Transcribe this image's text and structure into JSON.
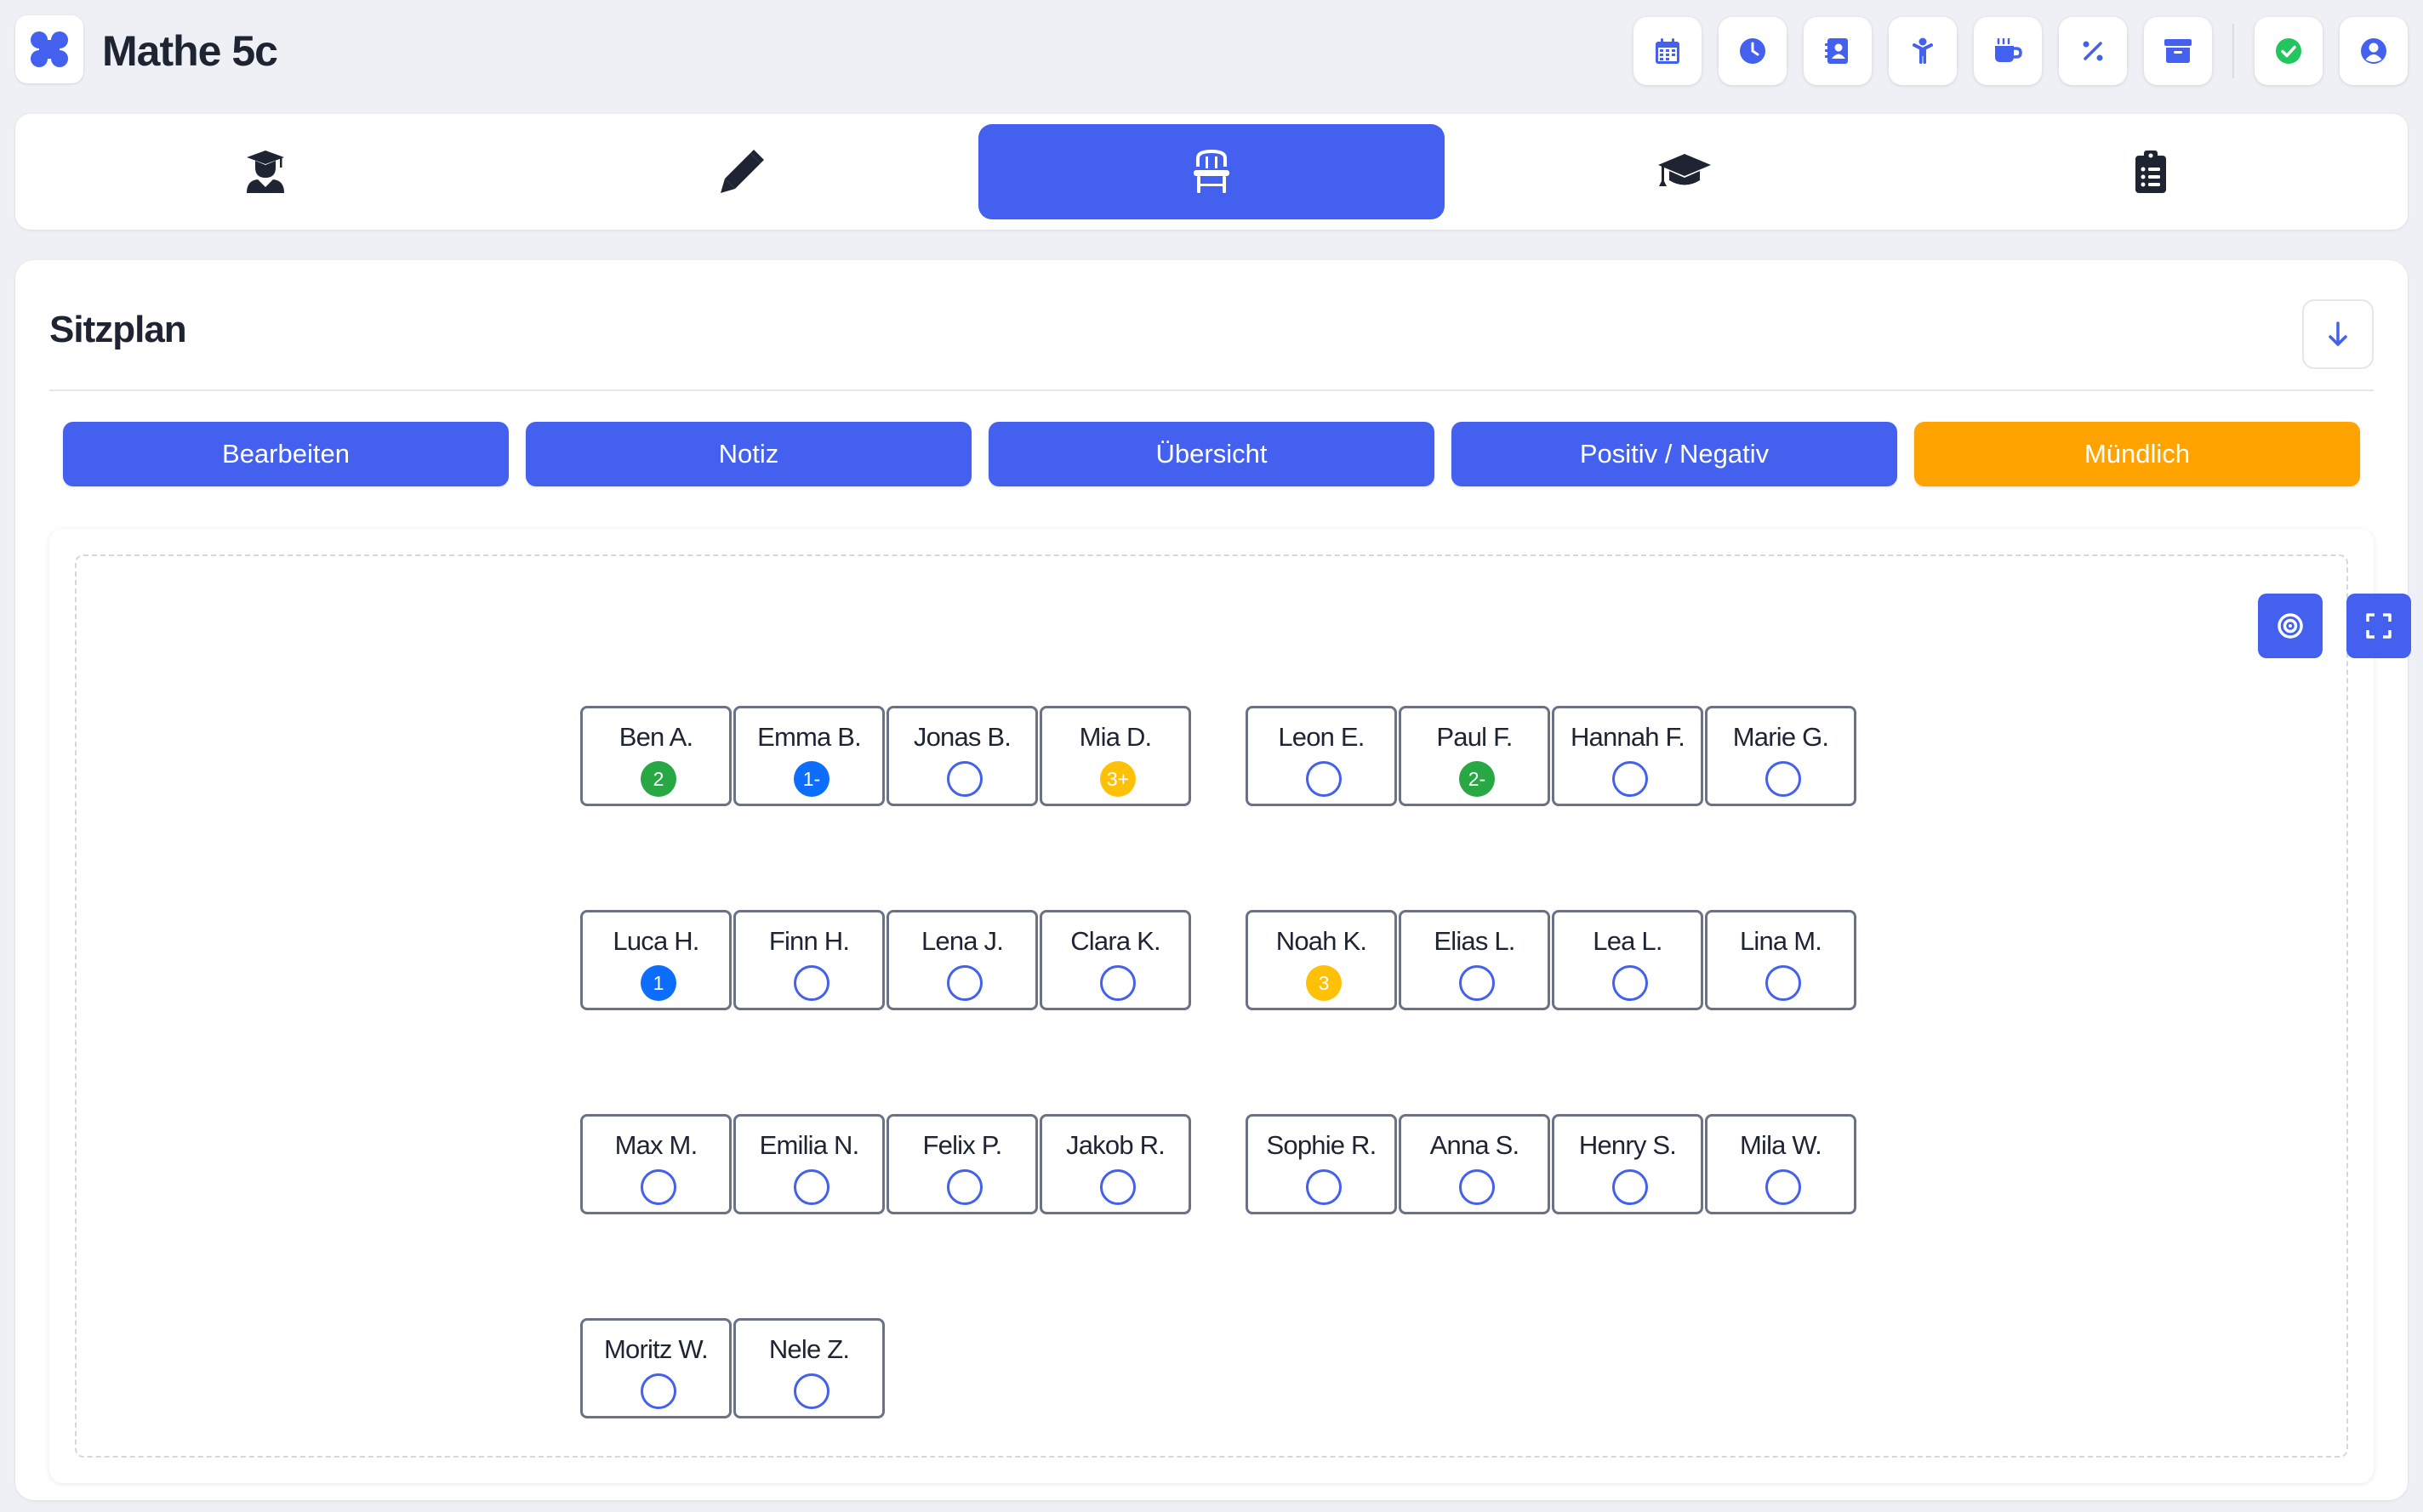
{
  "app": {
    "title": "Mathe 5c",
    "logo_icon": "apps-logo-icon"
  },
  "colors": {
    "accent": "#4361ee",
    "orange": "#ffa300",
    "grade_green": "#28a745",
    "grade_blue": "#0d6efd",
    "grade_yellow": "#ffc107",
    "success": "#22c55e"
  },
  "header_buttons": [
    {
      "name": "calendar-button",
      "icon": "calendar-icon"
    },
    {
      "name": "clock-button",
      "icon": "clock-icon"
    },
    {
      "name": "contacts-button",
      "icon": "contact-book-icon"
    },
    {
      "name": "child-button",
      "icon": "child-icon"
    },
    {
      "name": "break-button",
      "icon": "coffee-mug-icon"
    },
    {
      "name": "percent-button",
      "icon": "percent-icon"
    },
    {
      "name": "archive-button",
      "icon": "archive-box-icon"
    },
    {
      "name": "sync-status-button",
      "icon": "check-circle-icon"
    },
    {
      "name": "profile-button",
      "icon": "user-circle-icon"
    }
  ],
  "tabs": [
    {
      "name": "tab-students",
      "icon": "user-graduate-icon",
      "active": false
    },
    {
      "name": "tab-notes",
      "icon": "pencil-icon",
      "active": false
    },
    {
      "name": "tab-seating",
      "icon": "chair-icon",
      "active": true
    },
    {
      "name": "tab-grades",
      "icon": "graduation-cap-icon",
      "active": false
    },
    {
      "name": "tab-tasks",
      "icon": "clipboard-list-icon",
      "active": false
    }
  ],
  "section": {
    "title": "Sitzplan",
    "collapse_icon": "arrow-down-icon"
  },
  "modes": [
    {
      "label": "Bearbeiten",
      "active": false
    },
    {
      "label": "Notiz",
      "active": false
    },
    {
      "label": "Übersicht",
      "active": false
    },
    {
      "label": "Positiv / Negativ",
      "active": false
    },
    {
      "label": "Mündlich",
      "active": true
    }
  ],
  "room_tools": [
    {
      "name": "target-button",
      "icon": "target-icon"
    },
    {
      "name": "fullscreen-button",
      "icon": "fullscreen-icon"
    }
  ],
  "seats": [
    {
      "name": "Ben A.",
      "grade": "2",
      "color": "green"
    },
    {
      "name": "Emma B.",
      "grade": "1-",
      "color": "blue"
    },
    {
      "name": "Jonas B.",
      "grade": "",
      "color": "empty"
    },
    {
      "name": "Mia D.",
      "grade": "3+",
      "color": "yellow"
    },
    {
      "name": "Leon E.",
      "grade": "",
      "color": "empty"
    },
    {
      "name": "Paul F.",
      "grade": "2-",
      "color": "green"
    },
    {
      "name": "Hannah F.",
      "grade": "",
      "color": "empty"
    },
    {
      "name": "Marie G.",
      "grade": "",
      "color": "empty"
    },
    {
      "name": "Luca H.",
      "grade": "1",
      "color": "blue"
    },
    {
      "name": "Finn H.",
      "grade": "",
      "color": "empty"
    },
    {
      "name": "Lena J.",
      "grade": "",
      "color": "empty"
    },
    {
      "name": "Clara K.",
      "grade": "",
      "color": "empty"
    },
    {
      "name": "Noah K.",
      "grade": "3",
      "color": "yellow"
    },
    {
      "name": "Elias L.",
      "grade": "",
      "color": "empty"
    },
    {
      "name": "Lea L.",
      "grade": "",
      "color": "empty"
    },
    {
      "name": "Lina M.",
      "grade": "",
      "color": "empty"
    },
    {
      "name": "Max M.",
      "grade": "",
      "color": "empty"
    },
    {
      "name": "Emilia N.",
      "grade": "",
      "color": "empty"
    },
    {
      "name": "Felix P.",
      "grade": "",
      "color": "empty"
    },
    {
      "name": "Jakob R.",
      "grade": "",
      "color": "empty"
    },
    {
      "name": "Sophie R.",
      "grade": "",
      "color": "empty"
    },
    {
      "name": "Anna S.",
      "grade": "",
      "color": "empty"
    },
    {
      "name": "Henry S.",
      "grade": "",
      "color": "empty"
    },
    {
      "name": "Mila W.",
      "grade": "",
      "color": "empty"
    },
    {
      "name": "Moritz W.",
      "grade": "",
      "color": "empty"
    },
    {
      "name": "Nele Z.",
      "grade": "",
      "color": "empty"
    }
  ]
}
